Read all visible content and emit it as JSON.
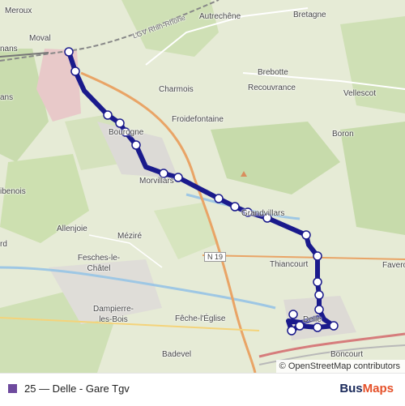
{
  "map": {
    "places": [
      {
        "id": "meroux",
        "label": "Meroux"
      },
      {
        "id": "moval",
        "label": "Moval"
      },
      {
        "id": "nans",
        "label": "nans"
      },
      {
        "id": "ans",
        "label": "ans"
      },
      {
        "id": "autrechene",
        "label": "Autrechêne"
      },
      {
        "id": "bretagne",
        "label": "Bretagne"
      },
      {
        "id": "brebotte",
        "label": "Brebotte"
      },
      {
        "id": "recouvrance",
        "label": "Recouvrance"
      },
      {
        "id": "vellescot",
        "label": "Vellescot"
      },
      {
        "id": "charmois",
        "label": "Charmois"
      },
      {
        "id": "froidefontaine",
        "label": "Froidefontaine"
      },
      {
        "id": "boron",
        "label": "Boron"
      },
      {
        "id": "bourogne",
        "label": "Bourogne"
      },
      {
        "id": "morvillars",
        "label": "Morvillars"
      },
      {
        "id": "grandvillars",
        "label": "Grandvillars"
      },
      {
        "id": "ibenois",
        "label": "ibenois"
      },
      {
        "id": "allenjoie",
        "label": "Allenjoie"
      },
      {
        "id": "rd",
        "label": "rd"
      },
      {
        "id": "mezire",
        "label": "Méziré"
      },
      {
        "id": "fesches",
        "label": "Fesches-le-Châtel"
      },
      {
        "id": "thiancourt",
        "label": "Thiancourt"
      },
      {
        "id": "faverois",
        "label": "Favero"
      },
      {
        "id": "dampierre",
        "label": "Dampierre-les-Bois"
      },
      {
        "id": "feche",
        "label": "Fêche-l'Église"
      },
      {
        "id": "badevel",
        "label": "Badevel"
      },
      {
        "id": "boncourt",
        "label": "Boncourt"
      },
      {
        "id": "delle",
        "label": "Delle"
      }
    ],
    "road_labels": {
      "highway": "LGV Rhin-Rhône",
      "n19": "N 19"
    },
    "route_color": "#1a1a8c",
    "stops_count": 22,
    "attribution": "© OpenStreetMap contributors"
  },
  "footer": {
    "line_color": "#6e4a9e",
    "line_label": "25 — Delle - Gare Tgv",
    "brand_part1": "Bus",
    "brand_part2": "Maps"
  }
}
